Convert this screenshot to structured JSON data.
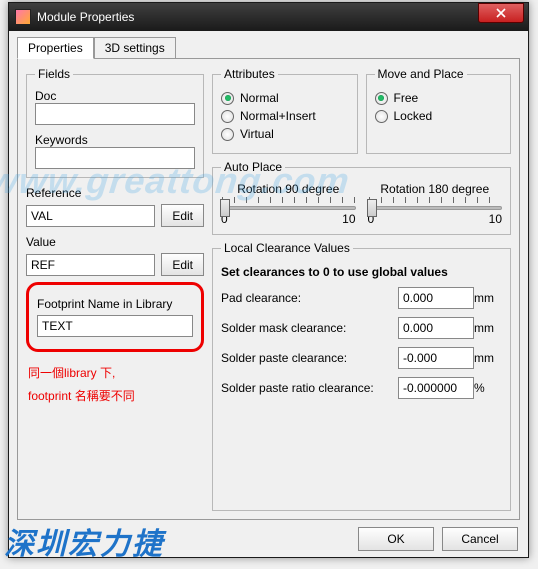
{
  "window": {
    "title": "Module Properties"
  },
  "tabs": {
    "properties": "Properties",
    "threed": "3D settings"
  },
  "fields_group": {
    "legend": "Fields",
    "doc_label": "Doc",
    "doc_value": "",
    "keywords_label": "Keywords",
    "keywords_value": ""
  },
  "reference": {
    "label": "Reference",
    "value": "VAL",
    "edit": "Edit"
  },
  "value": {
    "label": "Value",
    "value": "REF",
    "edit": "Edit"
  },
  "footprint": {
    "label": "Footprint Name in Library",
    "value": "TEXT"
  },
  "attributes": {
    "legend": "Attributes",
    "options": {
      "normal": "Normal",
      "normal_insert": "Normal+Insert",
      "virtual": "Virtual"
    },
    "selected": "normal"
  },
  "move_place": {
    "legend": "Move and Place",
    "options": {
      "free": "Free",
      "locked": "Locked"
    },
    "selected": "free"
  },
  "autoplace": {
    "legend": "Auto Place",
    "rot90": "Rotation 90 degree",
    "rot180": "Rotation 180 degree",
    "min": "0",
    "max": "10"
  },
  "clearance": {
    "legend": "Local Clearance Values",
    "note": "Set clearances to 0 to use global values",
    "rows": {
      "pad": {
        "label": "Pad clearance:",
        "value": "0.000",
        "unit": "mm"
      },
      "mask": {
        "label": "Solder mask clearance:",
        "value": "0.000",
        "unit": "mm"
      },
      "paste": {
        "label": "Solder paste clearance:",
        "value": "-0.000",
        "unit": "mm"
      },
      "ratio": {
        "label": "Solder paste ratio clearance:",
        "value": "-0.000000",
        "unit": "%"
      }
    }
  },
  "annotation": {
    "line1": "同一個library 下,",
    "line2": "footprint 名稱要不同"
  },
  "buttons": {
    "ok": "OK",
    "cancel": "Cancel"
  },
  "watermark": {
    "url": "www.greattong.com",
    "brand": "深圳宏力捷"
  }
}
